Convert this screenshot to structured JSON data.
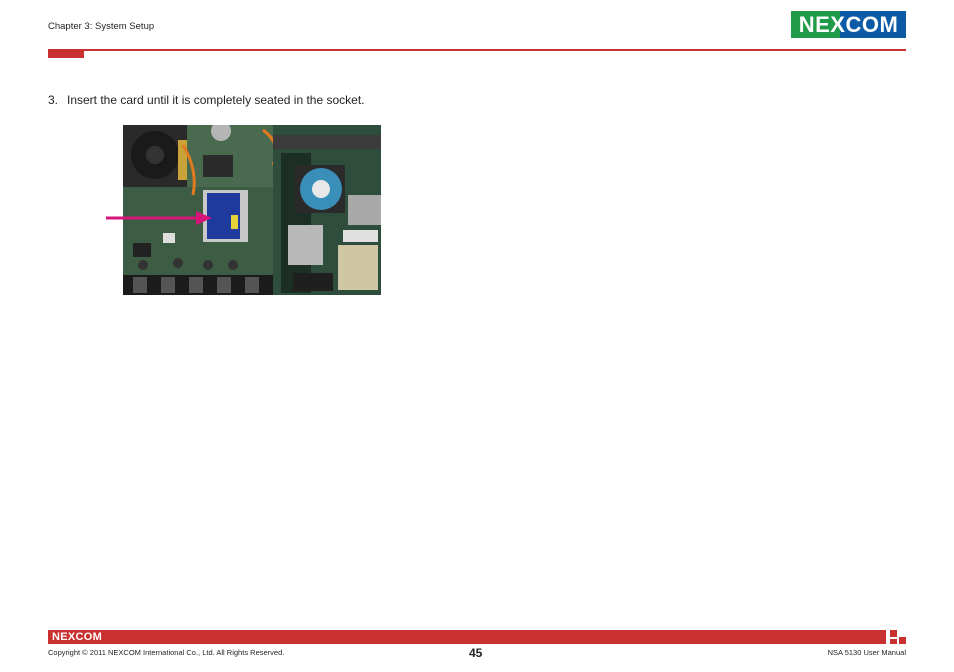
{
  "header": {
    "chapter": "Chapter 3: System Setup",
    "logo_text": "NEXCOM"
  },
  "content": {
    "step_number": "3.",
    "step_text": "Insert the card until it is completely seated in the socket."
  },
  "footer": {
    "logo_text": "NEXCOM",
    "copyright": "Copyright © 2011 NEXCOM International Co., Ltd. All Rights Reserved.",
    "page_number": "45",
    "manual_name": "NSA 5130 User Manual"
  },
  "colors": {
    "brand_red": "#c8312f",
    "logo_green": "#1f9a48",
    "logo_blue": "#0a5aa5",
    "arrow": "#d6147a"
  }
}
